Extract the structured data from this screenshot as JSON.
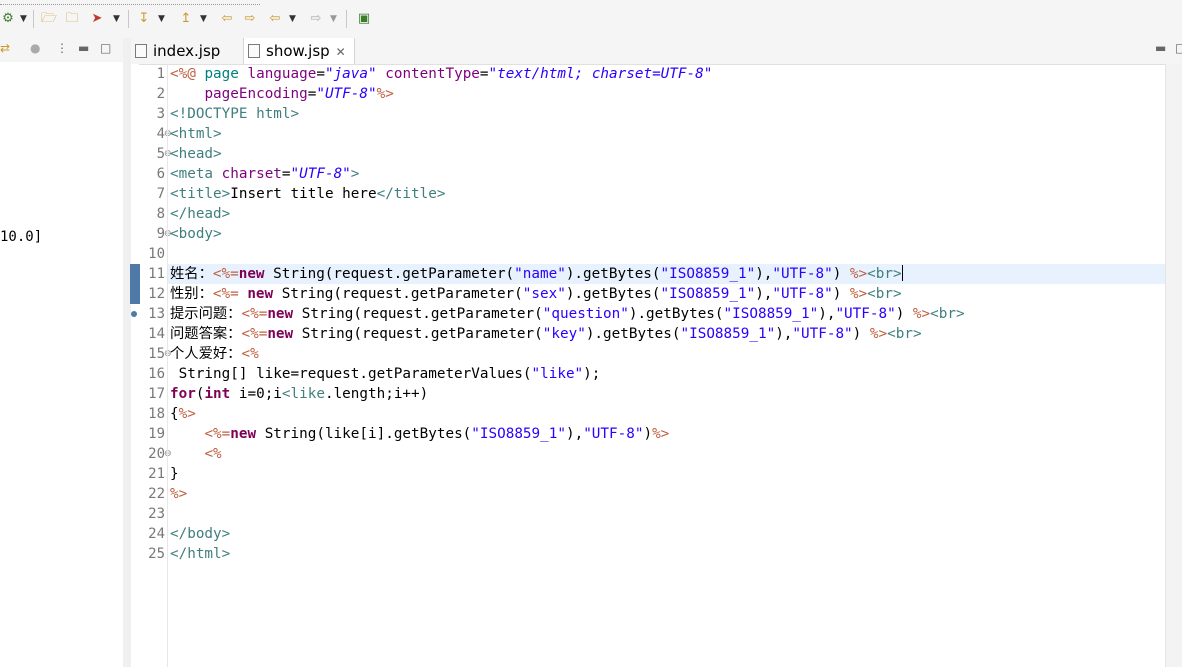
{
  "editor": {
    "tabs": [
      {
        "label": "index.jsp",
        "active": false
      },
      {
        "label": "show.jsp",
        "active": true
      }
    ],
    "active_line": 11
  },
  "left_view": {
    "fragment": "10.0]"
  },
  "toolbar": {
    "icons": [
      "new-server-icon",
      "open-folder-icon",
      "open-type-icon",
      "run-icon",
      "next-annotation-icon",
      "previous-annotation-icon",
      "last-edit-icon",
      "edit-location-icon",
      "back-icon",
      "forward-icon",
      "pin-editor-icon"
    ]
  },
  "code": {
    "lines": [
      {
        "n": "1",
        "t": "<%@ page language=\"java\" contentType=\"text/html; charset=UTF-8\""
      },
      {
        "n": "2",
        "t": "    pageEncoding=\"UTF-8\"%>"
      },
      {
        "n": "3",
        "t": "<!DOCTYPE html>"
      },
      {
        "n": "4",
        "t": "<html>"
      },
      {
        "n": "5",
        "t": "<head>"
      },
      {
        "n": "6",
        "t": "<meta charset=\"UTF-8\">"
      },
      {
        "n": "7",
        "t": "<title>Insert title here</title>"
      },
      {
        "n": "8",
        "t": "</head>"
      },
      {
        "n": "9",
        "t": "<body>"
      },
      {
        "n": "10",
        "t": ""
      },
      {
        "n": "11",
        "t": "姓名：<%=new String(request.getParameter(\"name\").getBytes(\"ISO8859_1\"),\"UTF-8\") %><br>"
      },
      {
        "n": "12",
        "t": "性别：<%= new String(request.getParameter(\"sex\").getBytes(\"ISO8859_1\"),\"UTF-8\") %><br>"
      },
      {
        "n": "13",
        "t": "提示问题：<%=new String(request.getParameter(\"question\").getBytes(\"ISO8859_1\"),\"UTF-8\") %><br>"
      },
      {
        "n": "14",
        "t": "问题答案：<%=new String(request.getParameter(\"key\").getBytes(\"ISO8859_1\"),\"UTF-8\") %><br>"
      },
      {
        "n": "15",
        "t": "个人爱好：<%"
      },
      {
        "n": "16",
        "t": " String[] like=request.getParameterValues(\"like\");"
      },
      {
        "n": "17",
        "t": "for(int i=0;i<like.length;i++)"
      },
      {
        "n": "18",
        "t": "{%>"
      },
      {
        "n": "19",
        "t": "    <%=new String(like[i].getBytes(\"ISO8859_1\"),\"UTF-8\")%>"
      },
      {
        "n": "20",
        "t": "    <%"
      },
      {
        "n": "21",
        "t": "}"
      },
      {
        "n": "22",
        "t": "%>"
      },
      {
        "n": "23",
        "t": ""
      },
      {
        "n": "24",
        "t": "</body>"
      },
      {
        "n": "25",
        "t": "</html>"
      }
    ]
  }
}
